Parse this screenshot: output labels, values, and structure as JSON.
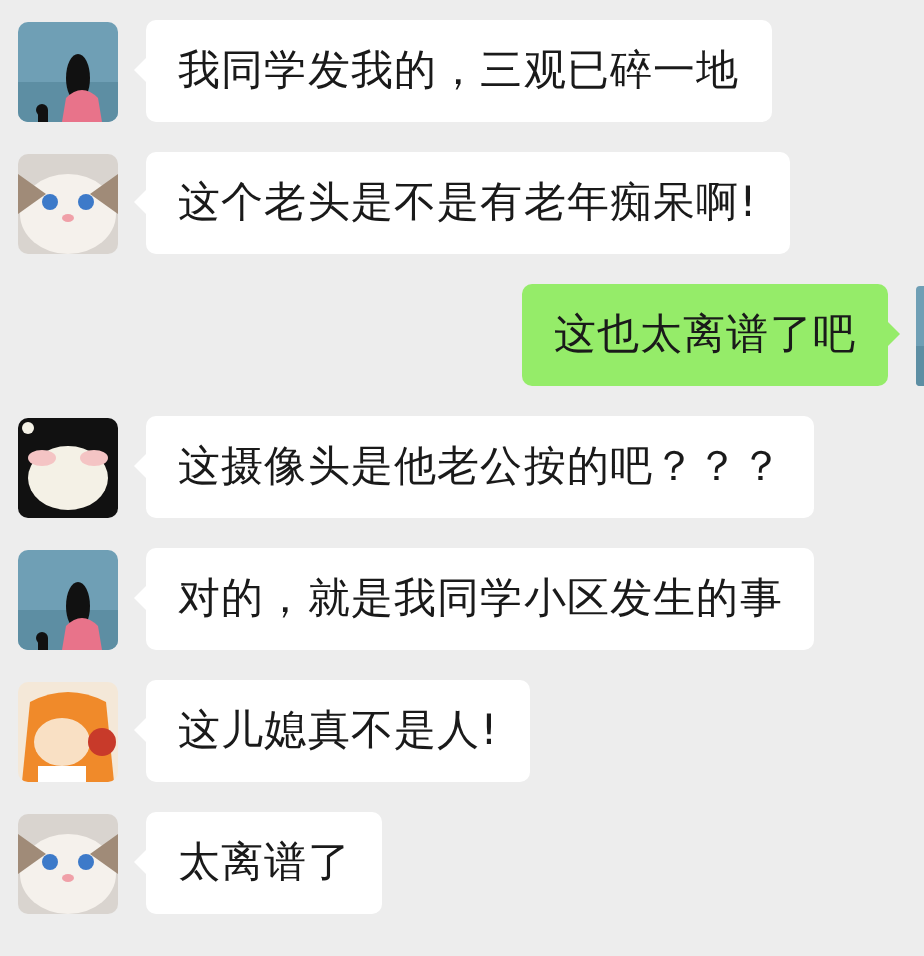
{
  "messages": [
    {
      "kind": "received",
      "text": "我同学发我的，三观已碎一地"
    },
    {
      "kind": "received",
      "text": "这个老头是不是有老年痴呆啊!"
    },
    {
      "kind": "sent",
      "text": "这也太离谱了吧"
    },
    {
      "kind": "received",
      "text": "这摄像头是他老公按的吧？？？"
    },
    {
      "kind": "received",
      "text": "对的，就是我同学小区发生的事"
    },
    {
      "kind": "received",
      "text": "这儿媳真不是人!"
    },
    {
      "kind": "received",
      "text": "太离谱了"
    }
  ]
}
